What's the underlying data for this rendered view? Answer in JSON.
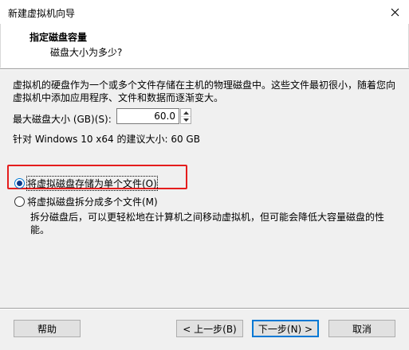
{
  "window": {
    "title": "新建虚拟机向导"
  },
  "header": {
    "title": "指定磁盘容量",
    "subtitle": "磁盘大小为多少?"
  },
  "description": "虚拟机的硬盘作为一个或多个文件存储在主机的物理磁盘中。这些文件最初很小，随着您向虚拟机中添加应用程序、文件和数据而逐渐变大。",
  "disk": {
    "label": "最大磁盘大小 (GB)(S):",
    "value": "60.0",
    "recommendation": "针对 Windows 10 x64 的建议大小: 60 GB"
  },
  "options": {
    "single": {
      "label": "将虚拟磁盘存储为单个文件(O)",
      "selected": true
    },
    "split": {
      "label": "将虚拟磁盘拆分成多个文件(M)",
      "selected": false
    },
    "split_note": "拆分磁盘后，可以更轻松地在计算机之间移动虚拟机，但可能会降低大容量磁盘的性能。"
  },
  "buttons": {
    "help": "帮助",
    "back": "< 上一步(B)",
    "next": "下一步(N) >",
    "cancel": "取消"
  },
  "colors": {
    "highlight": "#e51d1d",
    "accent": "#0078d4"
  }
}
